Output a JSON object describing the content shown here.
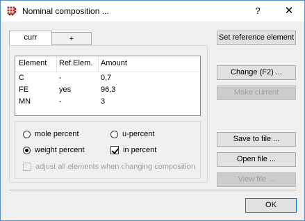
{
  "window": {
    "title": "Nominal composition ...",
    "help": "?",
    "close": "✕"
  },
  "tabs": [
    {
      "label": "curr"
    },
    {
      "label": "+"
    }
  ],
  "composition_table": {
    "columns": [
      "Element",
      "Ref.Elem.",
      "Amount"
    ],
    "rows": [
      [
        "C",
        "-",
        "0,7"
      ],
      [
        "FE",
        "yes",
        "96,3"
      ],
      [
        "MN",
        "-",
        "3"
      ]
    ]
  },
  "options": {
    "mole_percent": "mole percent",
    "u_percent": "u-percent",
    "weight_percent": "weight percent",
    "in_percent": "in percent",
    "adjust_all": "adjust all elements when changing composition",
    "selected_unit": "weight percent",
    "in_percent_checked": true,
    "adjust_all_checked": false
  },
  "buttons": {
    "set_reference": "Set reference element",
    "change": "Change (F2) ...",
    "make_current": "Make current",
    "save_to_file": "Save to file ...",
    "open_file": "Open file ...",
    "view_file": "View file ...",
    "ok": "OK"
  },
  "icons": {
    "app": "grid-dots-icon",
    "accent_color": "#c0392b"
  }
}
